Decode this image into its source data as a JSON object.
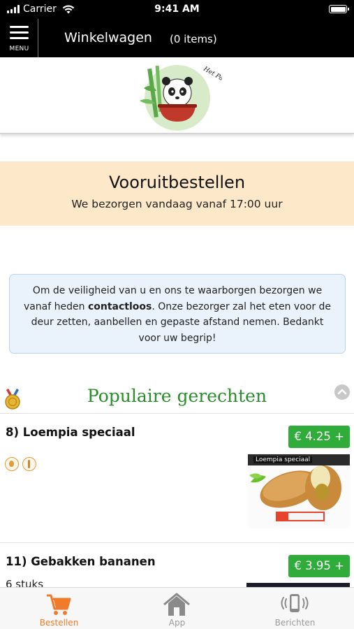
{
  "status_bar": {
    "carrier": "Carrier",
    "time": "9:41 AM"
  },
  "header": {
    "menu_label": "MENU",
    "title": "Winkelwagen",
    "item_count": "(0 items)"
  },
  "logo": {
    "text": "Het Pandahuis"
  },
  "preorder": {
    "title": "Vooruitbestellen",
    "subtitle": "We bezorgen vandaag vanaf 17:00 uur"
  },
  "notice": {
    "text_before": "Om de veiligheid van u en ons te waarborgen bezorgen we vanaf heden ",
    "emphasis": "contactloos",
    "text_after": ". Onze bezorger zal het eten voor de deur zetten, aanbellen en gepaste afstand nemen. Bedankt voor uw begrip!"
  },
  "section": {
    "title": "Populaire gerechten"
  },
  "items": [
    {
      "name": "8)  Loempia speciaal",
      "price": "€ 4.25 +",
      "image_label": "Loempia speciaal"
    },
    {
      "name": "11)  Gebakken bananen",
      "description": "6 stuks",
      "price": "€ 3.95 +"
    }
  ],
  "tabs": [
    {
      "label": "Bestellen",
      "icon": "cart-icon"
    },
    {
      "label": "App",
      "icon": "home-icon"
    },
    {
      "label": "Berichten",
      "icon": "phone-vibrate-icon"
    }
  ],
  "colors": {
    "accent_green": "#2fac3a",
    "title_green": "#2a8c2a",
    "active_orange": "#f07b2b",
    "banner_bg": "#fde8c9"
  }
}
